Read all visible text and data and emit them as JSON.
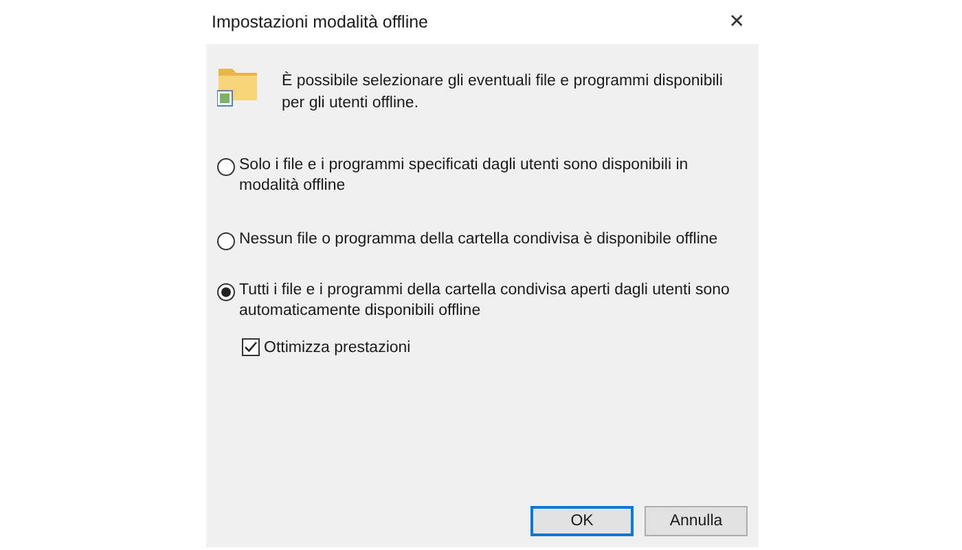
{
  "window": {
    "title": "Impostazioni modalità offline",
    "close": "✕"
  },
  "description": "È possibile selezionare gli eventuali file e programmi disponibili per gli utenti offline.",
  "options": [
    {
      "label": "Solo i file e i programmi specificati dagli utenti sono disponibili in modalità offline",
      "selected": false
    },
    {
      "label": "Nessun file o programma della cartella condivisa è disponibile offline",
      "selected": false
    },
    {
      "label": "Tutti i file e i programmi della cartella condivisa aperti dagli utenti sono automaticamente disponibili offline",
      "selected": true
    }
  ],
  "checkbox": {
    "label": "Ottimizza prestazioni",
    "checked": true
  },
  "buttons": [
    {
      "label": "OK",
      "kind": "default"
    },
    {
      "label": "Annulla",
      "kind": "normal"
    }
  ]
}
